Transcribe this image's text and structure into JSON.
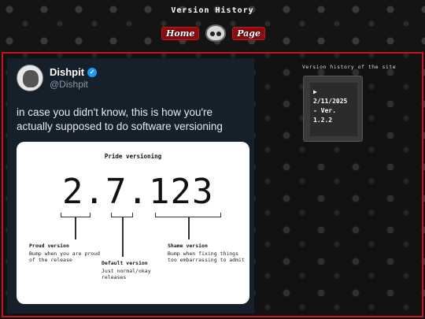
{
  "site": {
    "title": "Version History",
    "nav_left": "Home",
    "nav_right": "Page"
  },
  "tweet": {
    "display_name": "Dishpit",
    "handle": "@Dishpit",
    "verified_icon": "check-badge-icon",
    "text": "in case you didn't know, this is how you're actually supposed to do software versioning",
    "image": {
      "title": "Pride versioning",
      "version": "2.7.123",
      "proud_label": "Proud version",
      "proud_desc": "Bump when you are proud of the release",
      "default_label": "Default version",
      "default_desc": "Just normal/okay releases",
      "shame_label": "Shame version",
      "shame_desc": "Bump when fixing things too embarrassing to admit"
    }
  },
  "sidebar": {
    "caption": "Version history of the site",
    "entry": "▶ 2/11/2025 - Ver. 1.2.2"
  },
  "colors": {
    "accent_red": "#c4161c",
    "tweet_bg": "#15202b",
    "verified_blue": "#1d9bf0"
  }
}
